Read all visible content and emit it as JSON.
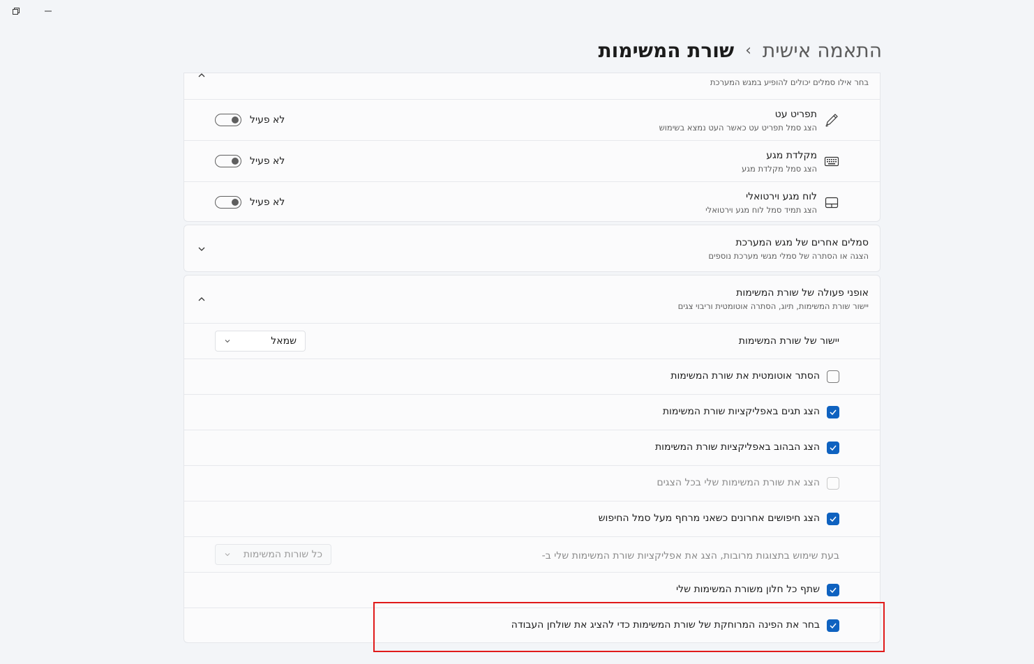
{
  "window": {
    "restore_icon": "restore-icon",
    "minimize_icon": "minimize-icon"
  },
  "header": {
    "parent": "התאמה אישית",
    "separator": "›",
    "current": "שורת המשימות"
  },
  "pen_section": {
    "subtitle": "בחר אילו סמלים יכולים להופיע במגש המערכת",
    "items": [
      {
        "title": "תפריט עט",
        "subtitle": "הצג סמל תפריט עט כאשר העט נמצא בשימוש",
        "state": "לא פעיל",
        "icon": "pen-icon"
      },
      {
        "title": "מקלדת מגע",
        "subtitle": "הצג סמל מקלדת מגע",
        "state": "לא פעיל",
        "icon": "keyboard-icon"
      },
      {
        "title": "לוח מגע וירטואלי",
        "subtitle": "הצג תמיד סמל לוח מגע וירטואלי",
        "state": "לא פעיל",
        "icon": "touchpad-icon"
      }
    ]
  },
  "other_tray": {
    "title": "סמלים אחרים של מגש המערכת",
    "subtitle": "הצגה או הסתרה של סמלי מגשי מערכת נוספים"
  },
  "behaviors": {
    "title": "אופני פעולה של שורת המשימות",
    "subtitle": "יישור שורת המשימות, תיוג, הסתרה אוטומטית וריבוי צגים",
    "alignment_label": "יישור של שורת המשימות",
    "alignment_value": "שמאל",
    "options": [
      "הסתר אוטומטית את שורת המשימות",
      "הצג תגים באפליקציות שורת המשימות",
      "הצג הבהוב באפליקציות שורת המשימות",
      "הצג את שורת המשימות שלי בכל הצגים",
      "הצג חיפושים אחרונים כשאני מרחף מעל סמל החיפוש"
    ],
    "multi_label": "בעת שימוש בתצוגות מרובות, הצג את אפליקציות שורת המשימות שלי ב-",
    "multi_value": "כל שורות המשימות",
    "share_label": "שתף כל חלון משורת המשימות שלי",
    "far_corner_label": "בחר את הפינה המרוחקת של שורת המשימות כדי להציג את שולחן העבודה"
  },
  "colors": {
    "accent": "#0f62c0",
    "highlight": "#e01a1a"
  }
}
